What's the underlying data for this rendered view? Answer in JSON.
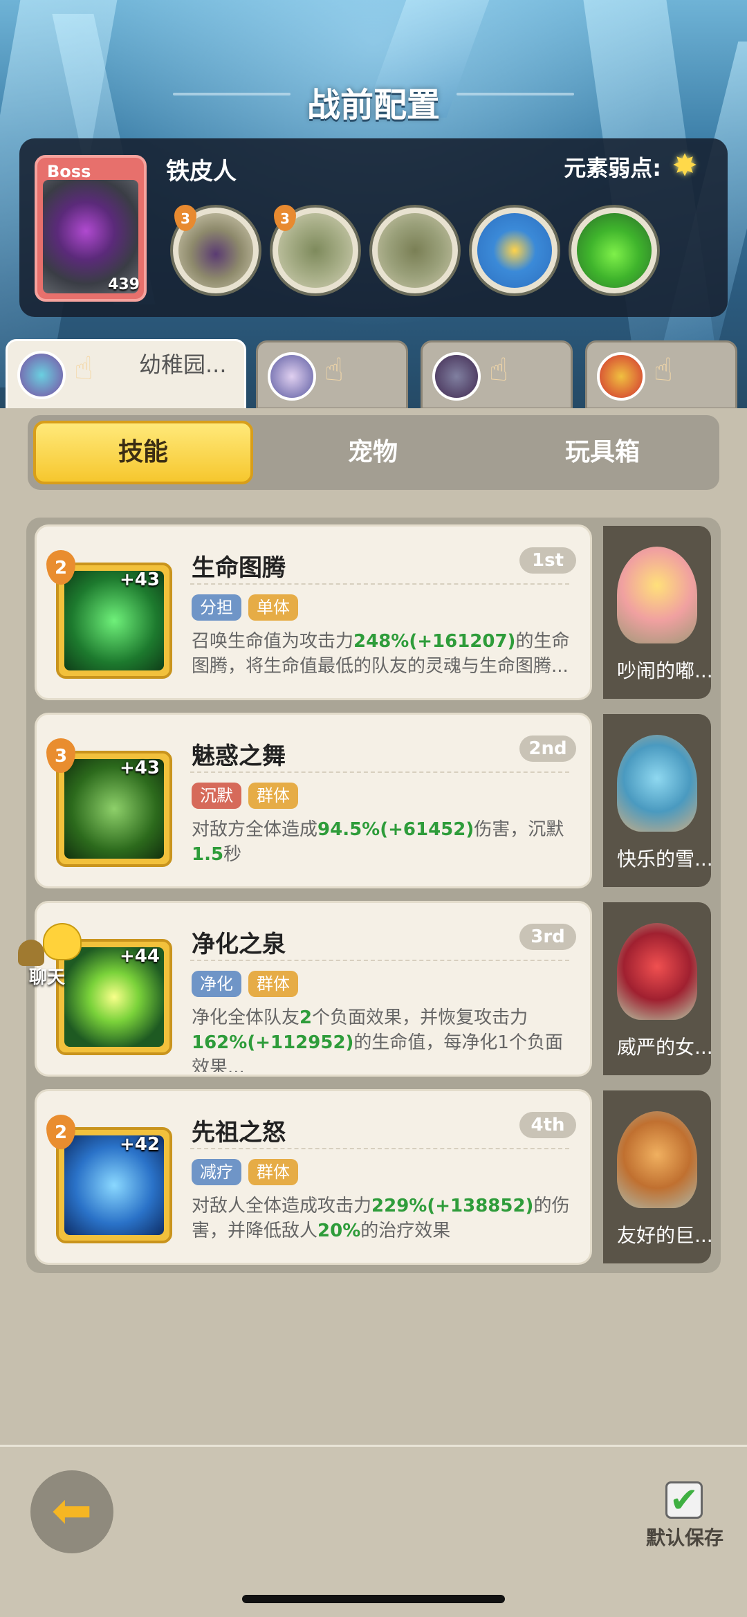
{
  "header": {
    "title": "战前配置"
  },
  "boss": {
    "tag": "Boss",
    "level": "439",
    "name": "铁皮人",
    "weakness_label": "元素弱点:",
    "weakness_icon": "star-burst-icon",
    "skills": [
      {
        "icon": "claw-armor-icon",
        "badge": "3"
      },
      {
        "icon": "shield-face-icon",
        "badge": "3"
      },
      {
        "icon": "mossy-body-icon",
        "badge": ""
      },
      {
        "icon": "hourglass-icon",
        "badge": ""
      },
      {
        "icon": "green-slime-icon",
        "badge": ""
      }
    ]
  },
  "team_tabs": [
    {
      "name": "幼稚园...",
      "active": true
    },
    {
      "name": "",
      "active": false
    },
    {
      "name": "",
      "active": false
    },
    {
      "name": "",
      "active": false
    }
  ],
  "segments": [
    {
      "label": "技能",
      "active": true
    },
    {
      "label": "宠物",
      "active": false
    },
    {
      "label": "玩具箱",
      "active": false
    }
  ],
  "skills": [
    {
      "title": "生命图腾",
      "rank": "1st",
      "level": "2",
      "plus": "+43",
      "tags": [
        {
          "text": "分担",
          "color": "#6f95c7"
        },
        {
          "text": "单体",
          "color": "#e6ac46"
        }
      ],
      "desc_parts": [
        "召唤生命值为攻击力",
        "248%(+161207)",
        "的生命图腾，将生命值最低的队友的灵魂与生命图腾..."
      ],
      "pet": "吵闹的嘟..."
    },
    {
      "title": "魅惑之舞",
      "rank": "2nd",
      "level": "3",
      "plus": "+43",
      "tags": [
        {
          "text": "沉默",
          "color": "#d66a5a"
        },
        {
          "text": "群体",
          "color": "#e6ac46"
        }
      ],
      "desc_parts": [
        "对敌方全体造成",
        "94.5%(+61452)",
        "伤害，沉默",
        "1.5",
        "秒"
      ],
      "pet": "快乐的雪..."
    },
    {
      "title": "净化之泉",
      "rank": "3rd",
      "level": "",
      "plus": "+44",
      "tags": [
        {
          "text": "净化",
          "color": "#6f95c7"
        },
        {
          "text": "群体",
          "color": "#e6ac46"
        }
      ],
      "desc_parts": [
        "净化全体队友",
        "2",
        "个负面效果，并恢复攻击力",
        "162%(+112952)",
        "的生命值，每净化1个负面效果..."
      ],
      "pet": "威严的女..."
    },
    {
      "title": "先祖之怒",
      "rank": "4th",
      "level": "2",
      "plus": "+42",
      "tags": [
        {
          "text": "减疗",
          "color": "#6f95c7"
        },
        {
          "text": "群体",
          "color": "#e6ac46"
        }
      ],
      "desc_parts": [
        "对敌人全体造成攻击力",
        "229%(+138852)",
        "的伤害，并降低敌人",
        "20%",
        "的治疗效果"
      ],
      "pet": "友好的巨..."
    }
  ],
  "chat": {
    "label": "聊天"
  },
  "footer": {
    "save_label": "默认保存",
    "back_icon": "back-arrow-icon"
  }
}
